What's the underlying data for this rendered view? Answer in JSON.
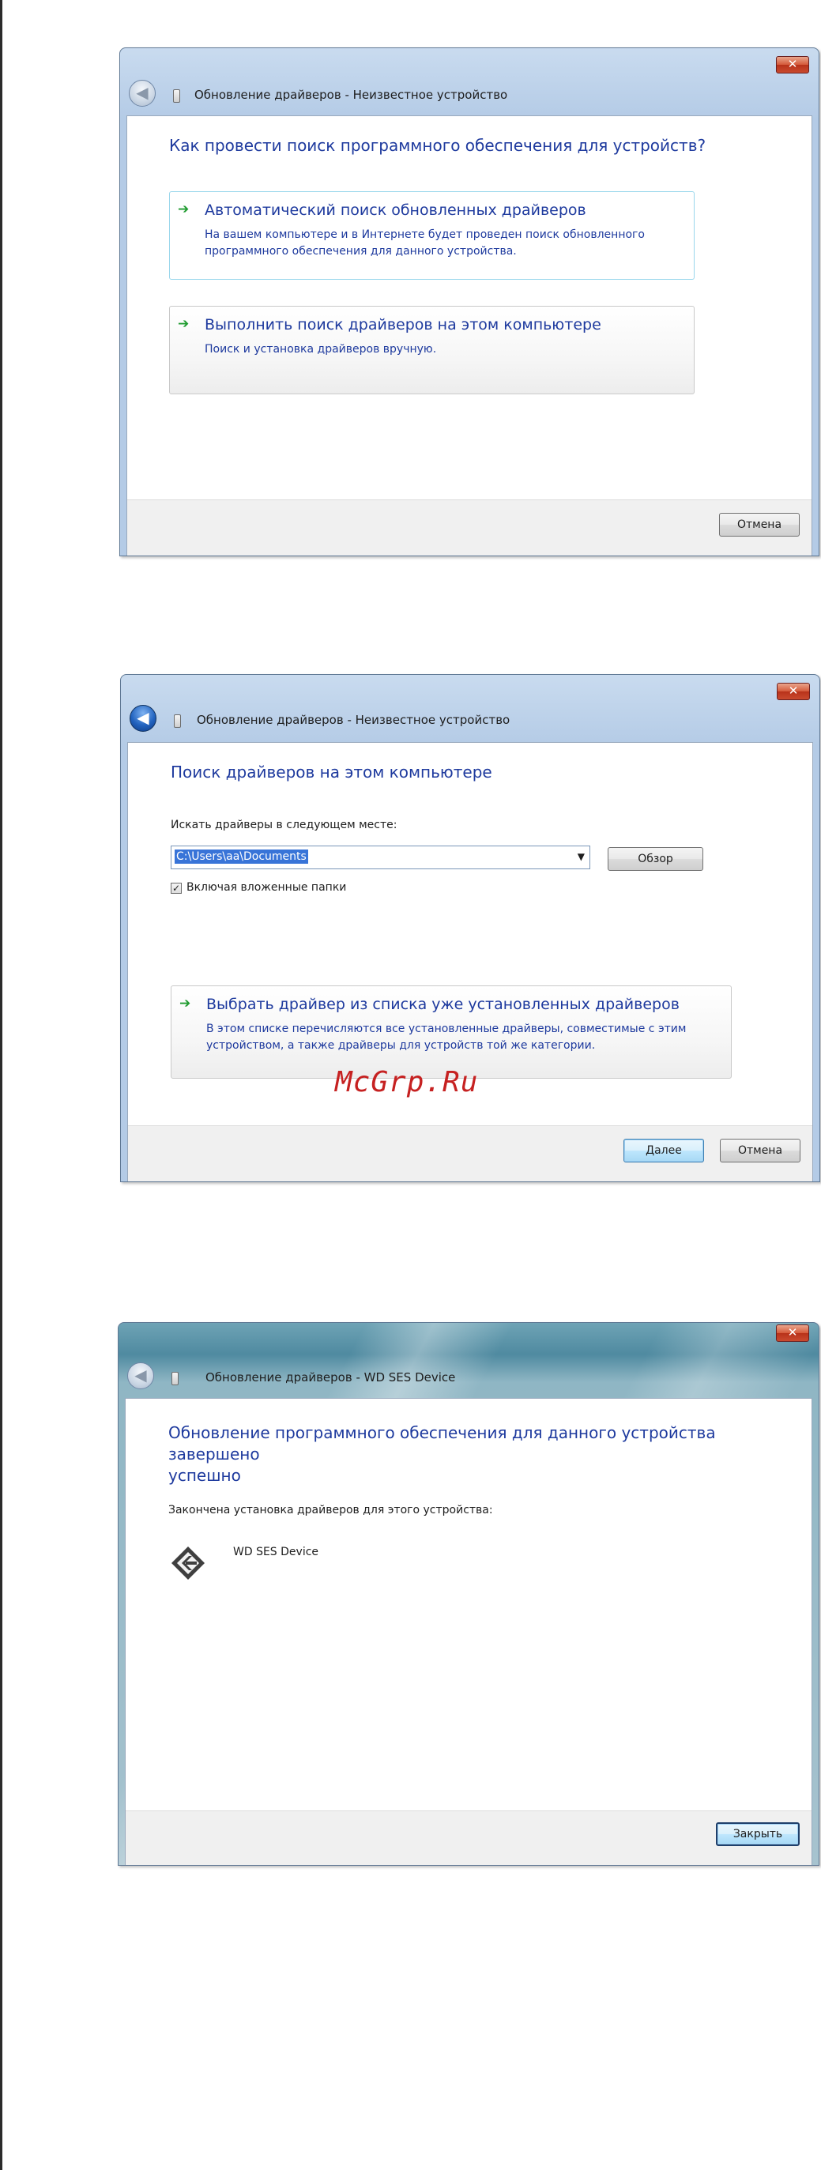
{
  "watermark": "McGrp.Ru",
  "dialog1": {
    "title": "Обновление драйверов - Неизвестное устройство",
    "heading": "Как провести поиск программного обеспечения для устройств?",
    "option_auto": {
      "title": "Автоматический поиск обновленных драйверов",
      "desc_line1": "На вашем компьютере и в Интернете будет проведен поиск обновленного",
      "desc_line2": "программного обеспечения для данного устройства."
    },
    "option_manual": {
      "title": "Выполнить поиск драйверов на этом компьютере",
      "desc": "Поиск и установка драйверов вручную."
    },
    "cancel_label": "Отмена"
  },
  "dialog2": {
    "title": "Обновление драйверов - Неизвестное устройство",
    "heading": "Поиск драйверов на этом компьютере",
    "search_label": "Искать драйверы в следующем месте:",
    "path_value": "C:\\Users\\aa\\Documents",
    "browse_label": "Обзор",
    "include_subfolders_label": "Включая вложенные папки",
    "include_subfolders_checked": true,
    "option_list": {
      "title": "Выбрать драйвер из списка уже установленных драйверов",
      "desc_line1": "В этом списке перечисляются все установленные драйверы, совместимые с этим",
      "desc_line2": "устройством, а также драйверы для устройств той же категории."
    },
    "next_label": "Далее",
    "cancel_label": "Отмена"
  },
  "dialog3": {
    "title": "Обновление драйверов - WD SES Device",
    "heading_line1": "Обновление программного обеспечения для данного устройства завершено",
    "heading_line2": "успешно",
    "finished_label": "Закончена установка драйверов для этого устройства:",
    "device_name": "WD SES Device",
    "close_label": "Закрыть"
  },
  "icons": {
    "close": "close-icon",
    "back": "back-arrow-icon",
    "arrow": "green-arrow-icon",
    "device": "wd-device-icon",
    "dropdown": "chevron-down-icon"
  },
  "colors": {
    "heading_blue": "#1e3a9e",
    "arrow_green": "#1f9b2f",
    "watermark_red": "#c62121",
    "selection_blue": "#3874d8"
  }
}
